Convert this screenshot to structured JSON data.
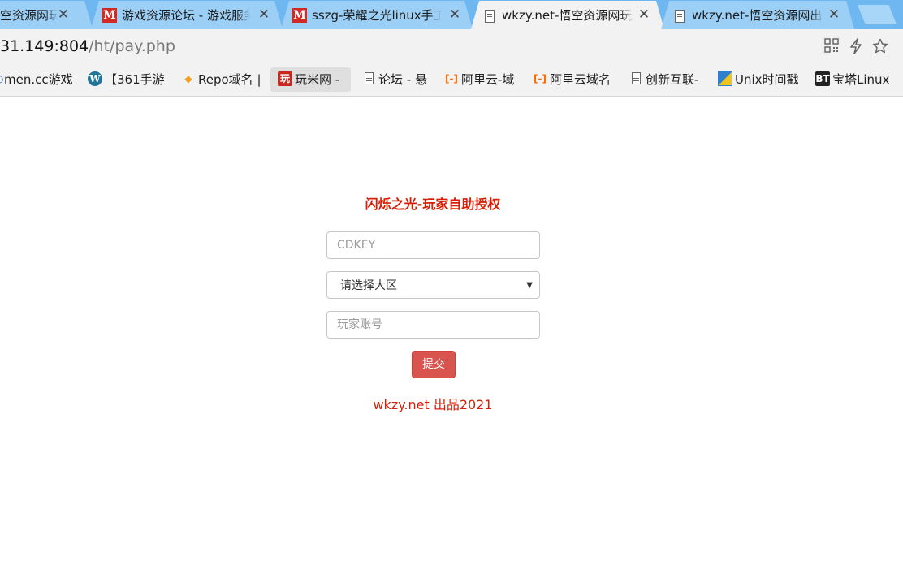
{
  "tabs": [
    {
      "title": "空资源网玩家",
      "favicon": "m-icon"
    },
    {
      "title": "游戏资源论坛 - 游戏服务",
      "favicon": "m-icon"
    },
    {
      "title": "sszg-荣耀之光linux手工",
      "favicon": "m-icon"
    },
    {
      "title": "wkzy.net-悟空资源网玩家",
      "favicon": "page-icon"
    },
    {
      "title": "wkzy.net-悟空资源网出品",
      "favicon": "page-icon"
    }
  ],
  "address": {
    "host": "31.149:804",
    "path": "/ht/pay.php"
  },
  "bookmarks": [
    {
      "label": "men.cc游戏",
      "icon": "dot-icon"
    },
    {
      "label": "【361手游",
      "icon": "wordpress-icon"
    },
    {
      "label": "Repo域名 |",
      "icon": "repo-icon"
    },
    {
      "label": "玩米网 -",
      "icon": "wanmi-icon"
    },
    {
      "label": "论坛 - 悬",
      "icon": "page-icon"
    },
    {
      "label": "阿里云-域",
      "icon": "aliyun-icon"
    },
    {
      "label": "阿里云域名",
      "icon": "aliyun-icon"
    },
    {
      "label": "创新互联-",
      "icon": "page-icon"
    },
    {
      "label": "Unix时间戳",
      "icon": "unix-icon"
    },
    {
      "label": "宝塔Linux",
      "icon": "bt-icon"
    }
  ],
  "form": {
    "heading": "闪烁之光-玩家自助授权",
    "cdkey_placeholder": "CDKEY",
    "server_select": "请选择大区",
    "account_placeholder": "玩家账号",
    "submit_label": "提交"
  },
  "footer": "wkzy.net 出品2021",
  "colors": {
    "heading_red": "#d81e06",
    "button_red": "#d9534f",
    "tabstrip_blue": "#6fb7f0"
  }
}
